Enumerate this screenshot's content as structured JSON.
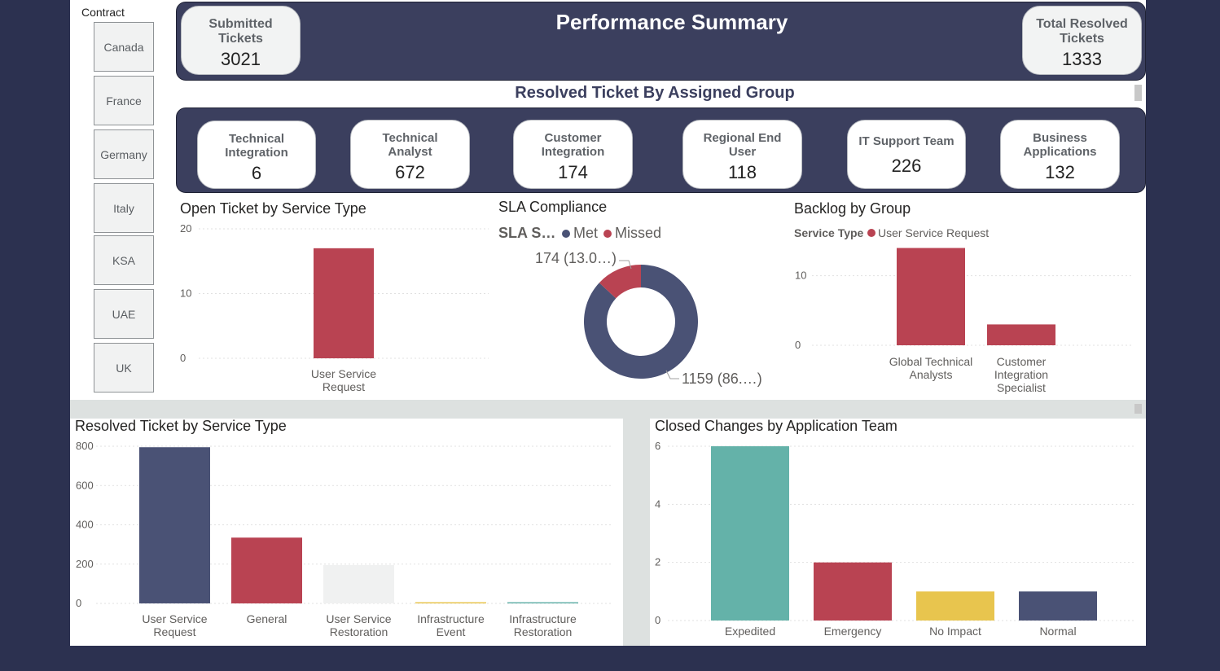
{
  "colors": {
    "navy": "#3b3f5e",
    "series_navy": "#4a5275",
    "red": "#b94352",
    "teal": "#64b2a9",
    "yellow": "#e8c54e",
    "light": "#f0f1f1"
  },
  "header": {
    "title": "Performance Summary",
    "submitted": {
      "label": "Submitted Tickets",
      "value": "3021"
    },
    "resolved": {
      "label": "Total Resolved Tickets",
      "value": "1333"
    }
  },
  "slicer": {
    "title": "Contract",
    "items": [
      "Canada",
      "France",
      "Germany",
      "Italy",
      "KSA",
      "UAE",
      "UK"
    ]
  },
  "groups": {
    "title": "Resolved Ticket By Assigned Group",
    "cards": [
      {
        "label": "Technical Integration",
        "value": "6"
      },
      {
        "label": "Technical Analyst",
        "value": "672"
      },
      {
        "label": "Customer Integration",
        "value": "174"
      },
      {
        "label": "Regional End User",
        "value": "118"
      },
      {
        "label": "IT Support Team",
        "value": "226"
      },
      {
        "label": "Business Applications",
        "value": "132"
      }
    ]
  },
  "chart_data": [
    {
      "id": "open",
      "type": "bar",
      "title": "Open Ticket by Service Type",
      "categories": [
        "User Service Request"
      ],
      "values": [
        17
      ],
      "colors": [
        "#b94352"
      ],
      "ylim": [
        0,
        20
      ],
      "yticks": [
        "0",
        "10",
        "20"
      ],
      "grid": true
    },
    {
      "id": "sla",
      "type": "pie",
      "title": "SLA Compliance",
      "legend_title": "SLA S…",
      "legend": [
        {
          "name": "Met",
          "color": "#4a5275"
        },
        {
          "name": "Missed",
          "color": "#b94352"
        }
      ],
      "values": [
        1159,
        174
      ],
      "colors": [
        "#4a5275",
        "#b94352"
      ],
      "labels": [
        "1159 (86.…)",
        "174 (13.0…)"
      ]
    },
    {
      "id": "backlog",
      "type": "bar",
      "title": "Backlog by Group",
      "legend_title": "Service Type",
      "legend": [
        {
          "name": "User Service Request",
          "color": "#b94352"
        }
      ],
      "categories": [
        "Global Technical Analysts",
        "Customer Integration Specialist"
      ],
      "values": [
        14,
        3
      ],
      "colors": [
        "#b94352",
        "#b94352"
      ],
      "ylim": [
        0,
        15
      ],
      "yticks": [
        "0",
        "10"
      ],
      "grid": true
    },
    {
      "id": "resolved",
      "type": "bar",
      "title": "Resolved Ticket by Service Type",
      "categories": [
        "User Service Request",
        "General",
        "User Service Restoration",
        "Infrastructure Event",
        "Infrastructure Restoration"
      ],
      "values": [
        795,
        335,
        195,
        5,
        3
      ],
      "colors": [
        "#4a5275",
        "#b94352",
        "#f0f1f1",
        "#e8c54e",
        "#64b2a9"
      ],
      "ylim": [
        0,
        800
      ],
      "yticks": [
        "0",
        "200",
        "400",
        "600",
        "800"
      ],
      "grid": true
    },
    {
      "id": "changes",
      "type": "bar",
      "title": "Closed Changes by Application Team",
      "categories": [
        "Expedited",
        "Emergency",
        "No Impact",
        "Normal"
      ],
      "values": [
        6,
        2,
        1,
        1
      ],
      "colors": [
        "#64b2a9",
        "#b94352",
        "#e8c54e",
        "#4a5275"
      ],
      "ylim": [
        0,
        6
      ],
      "yticks": [
        "0",
        "2",
        "4",
        "6"
      ],
      "grid": true
    }
  ]
}
